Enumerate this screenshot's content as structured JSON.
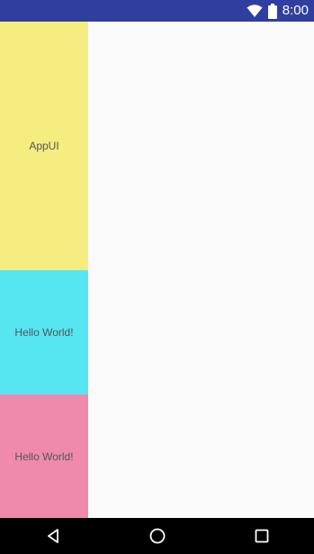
{
  "status_bar": {
    "time": "8:00",
    "icons": [
      "wifi-icon",
      "battery-icon"
    ],
    "background": "#303f9f"
  },
  "panels": [
    {
      "label": "AppUI",
      "color": "#f5ed7f"
    },
    {
      "label": "Hello World!",
      "color": "#55e6f2"
    },
    {
      "label": "Hello World!",
      "color": "#f08aac"
    }
  ],
  "nav_bar": {
    "buttons": [
      "back-icon",
      "home-icon",
      "recent-apps-icon"
    ],
    "background": "#000000"
  }
}
